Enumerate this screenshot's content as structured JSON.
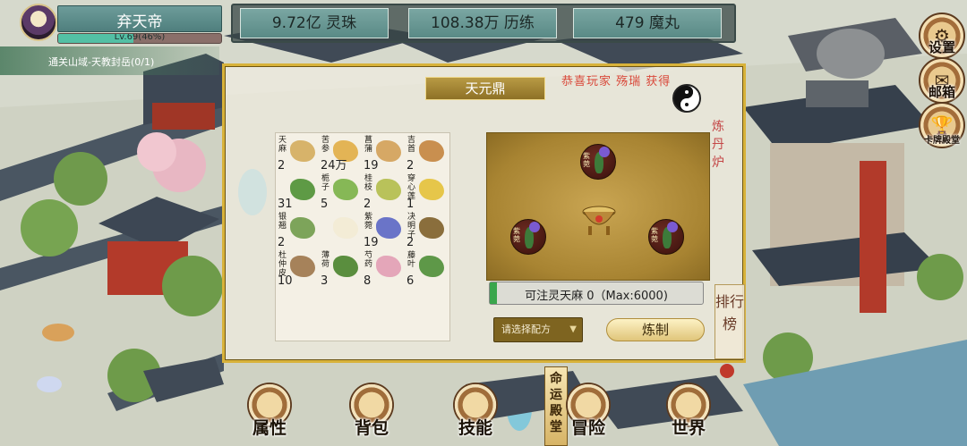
{
  "player": {
    "name": "弃天帝",
    "level_text": "Lv.69(46%)",
    "level_progress": 0.46,
    "quest": "通关山域-天教封岳(0/1)"
  },
  "resources": [
    {
      "label": "9.72亿 灵珠"
    },
    {
      "label": "108.38万 历练"
    },
    {
      "label": "479 魔丸"
    }
  ],
  "side_menu": {
    "settings": "设置",
    "mail": "邮箱",
    "hall": "卡牌殿堂",
    "settings_icon": "gear-icon",
    "mail_icon": "envelope-icon",
    "hall_icon": "trophy-icon"
  },
  "modal": {
    "title": "天元鼎",
    "notice": "恭喜玩家 殇瑞 获得",
    "furnace_label": "炼丹炉",
    "herbs": [
      {
        "name": "天麻",
        "count": "2",
        "color": "#d7b36a"
      },
      {
        "name": "苦参",
        "count": "24万",
        "color": "#e3b455"
      },
      {
        "name": "菖蒲",
        "count": "19",
        "color": "#d6a865"
      },
      {
        "name": "吉首",
        "count": "2",
        "color": "#c98f4f"
      },
      {
        "name": "",
        "count": "31",
        "color": "#5e9a45"
      },
      {
        "name": "栀子",
        "count": "5",
        "color": "#86b856"
      },
      {
        "name": "桂枝",
        "count": "2",
        "color": "#b9c25a"
      },
      {
        "name": "穿心莲",
        "count": "1",
        "color": "#e6c64a"
      },
      {
        "name": "银翘",
        "count": "2",
        "color": "#7da45a"
      },
      {
        "name": "",
        "count": "",
        "color": "#f2e7c8"
      },
      {
        "name": "紫菀",
        "count": "19",
        "color": "#6a74c8"
      },
      {
        "name": "决明子",
        "count": "2",
        "color": "#8a6e3c"
      },
      {
        "name": "杜仲皮",
        "count": "10",
        "color": "#a6825a"
      },
      {
        "name": "薄荷",
        "count": "3",
        "color": "#5a8e3e"
      },
      {
        "name": "芍药",
        "count": "8",
        "color": "#e4a6b9"
      },
      {
        "name": "藤叶",
        "count": "6",
        "color": "#5e9848"
      }
    ],
    "slot_tag": "紫菀",
    "inject_text": "可注灵天麻 0（Max:6000)",
    "inject_progress": 0,
    "select_recipe": "请选择配方",
    "refine_button": "炼制",
    "rank_banner": "排行榜"
  },
  "bottom_nav": [
    {
      "label": "属性"
    },
    {
      "label": "背包"
    },
    {
      "label": "技能"
    },
    {
      "label": "冒险"
    },
    {
      "label": "世界"
    }
  ],
  "vertical_banner": "命运殿堂"
}
